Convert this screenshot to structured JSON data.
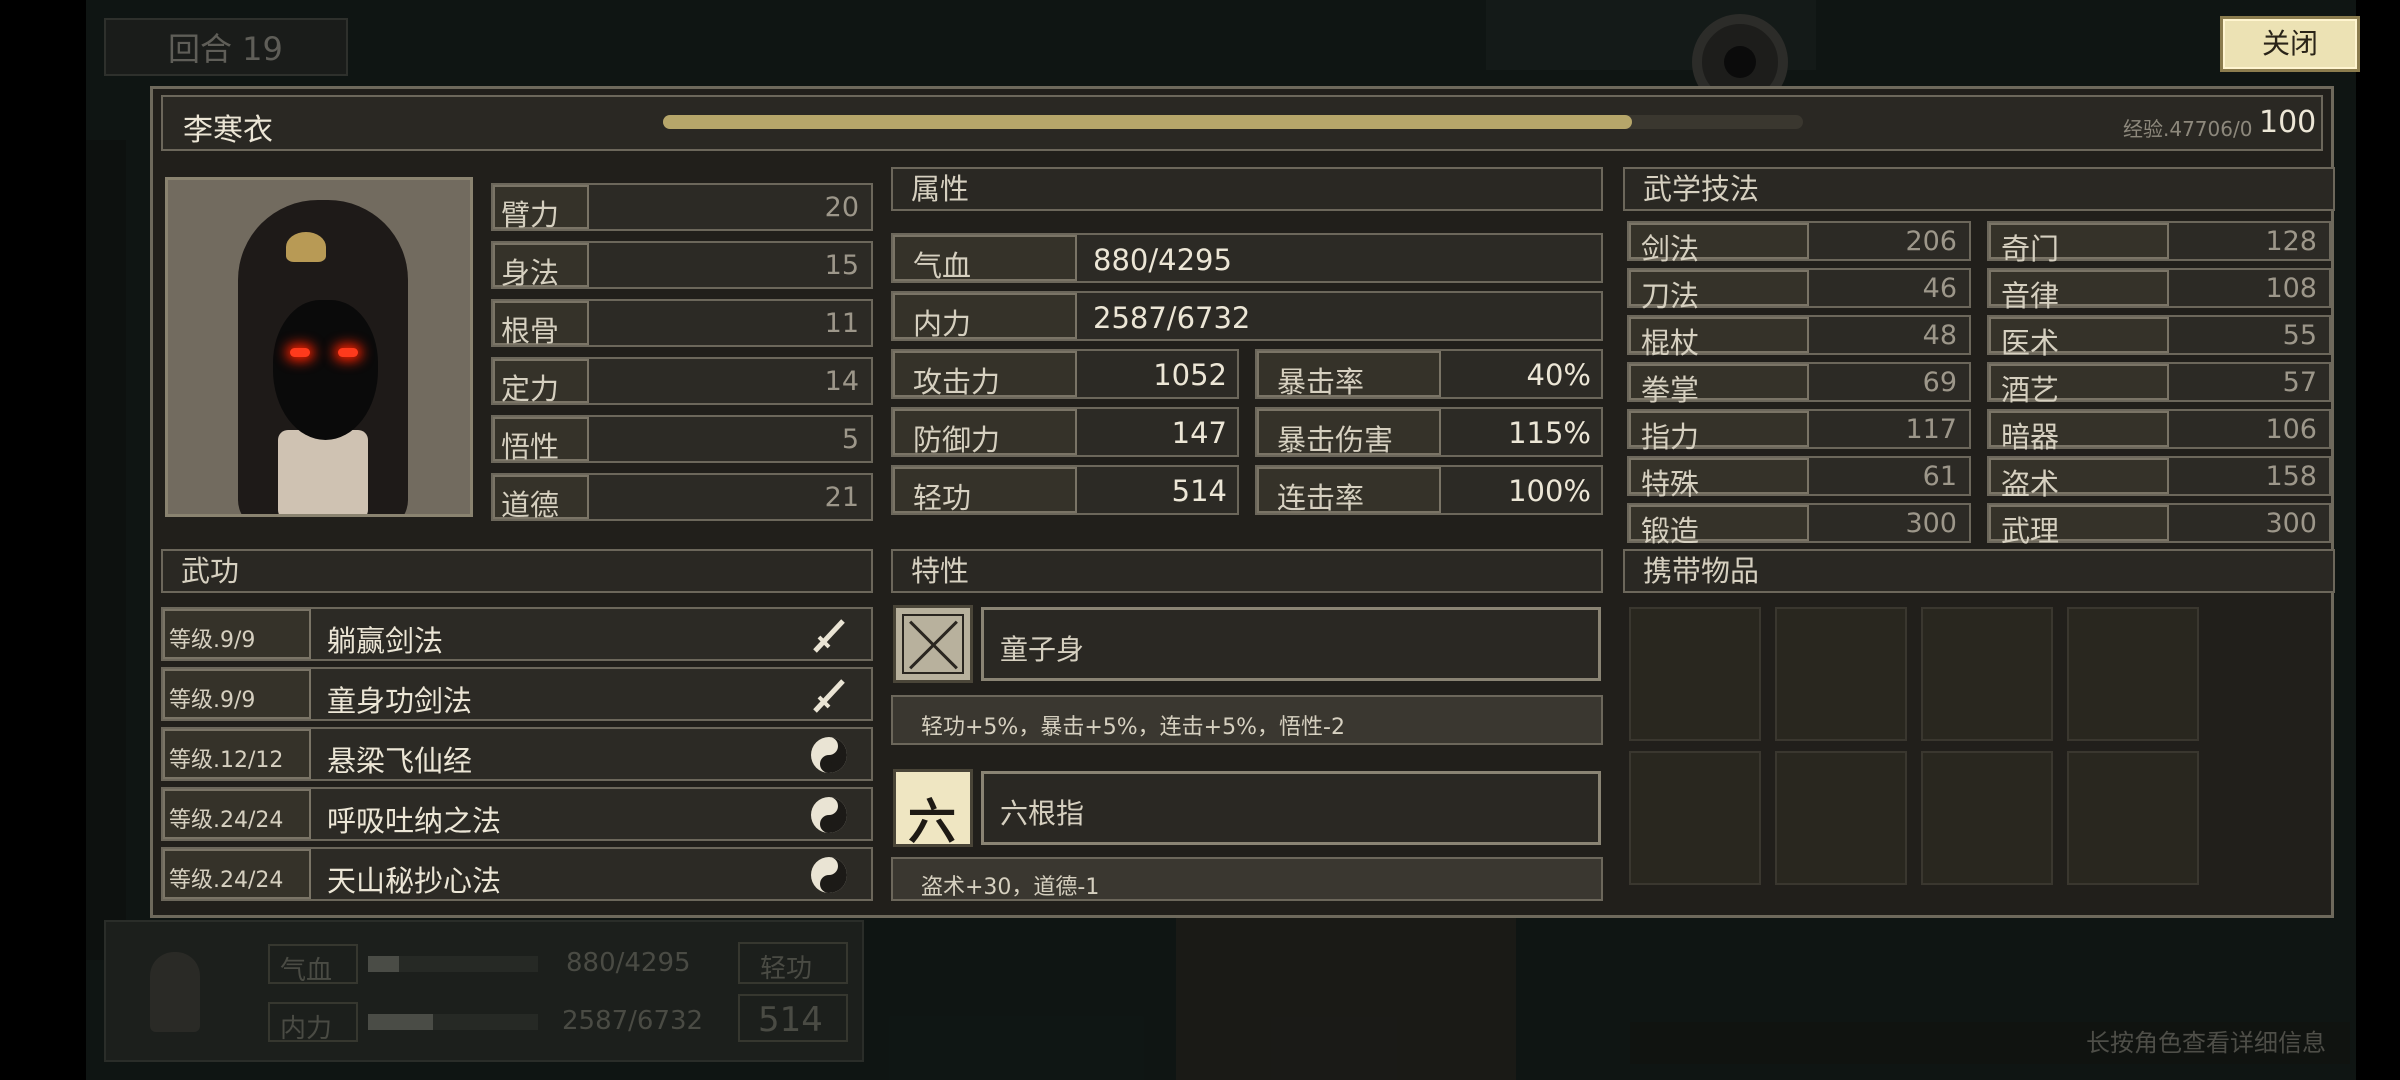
{
  "hud_top": {
    "turn": "回合 19"
  },
  "close_label": "关闭",
  "character": {
    "name": "李寒衣",
    "exp_label": "经验.47706/0",
    "level": "100",
    "exp_fill": 0.85
  },
  "base_stats": [
    {
      "label": "臂力",
      "value": "20"
    },
    {
      "label": "身法",
      "value": "15"
    },
    {
      "label": "根骨",
      "value": "11"
    },
    {
      "label": "定力",
      "value": "14"
    },
    {
      "label": "悟性",
      "value": "5"
    },
    {
      "label": "道德",
      "value": "21"
    }
  ],
  "attributes": {
    "title": "属性",
    "hp": {
      "label": "气血",
      "value": "880/4295"
    },
    "mp": {
      "label": "内力",
      "value": "2587/6732"
    },
    "left": [
      {
        "label": "攻击力",
        "value": "1052"
      },
      {
        "label": "防御力",
        "value": "147"
      },
      {
        "label": "轻功",
        "value": "514"
      }
    ],
    "right": [
      {
        "label": "暴击率",
        "value": "40%"
      },
      {
        "label": "暴击伤害",
        "value": "115%"
      },
      {
        "label": "连击率",
        "value": "100%"
      }
    ]
  },
  "skills": {
    "title": "武学技法",
    "left": [
      {
        "label": "剑法",
        "value": "206"
      },
      {
        "label": "刀法",
        "value": "46"
      },
      {
        "label": "棍杖",
        "value": "48"
      },
      {
        "label": "拳掌",
        "value": "69"
      },
      {
        "label": "指力",
        "value": "117"
      },
      {
        "label": "特殊",
        "value": "61"
      },
      {
        "label": "锻造",
        "value": "300"
      }
    ],
    "right": [
      {
        "label": "奇门",
        "value": "128"
      },
      {
        "label": "音律",
        "value": "108"
      },
      {
        "label": "医术",
        "value": "55"
      },
      {
        "label": "酒艺",
        "value": "57"
      },
      {
        "label": "暗器",
        "value": "106"
      },
      {
        "label": "盗术",
        "value": "158"
      },
      {
        "label": "武理",
        "value": "300"
      }
    ]
  },
  "martial_arts": {
    "title": "武功",
    "items": [
      {
        "level": "等级.9/9",
        "name": "躺赢剑法",
        "icon": "sword-icon"
      },
      {
        "level": "等级.9/9",
        "name": "童身功剑法",
        "icon": "sword-icon"
      },
      {
        "level": "等级.12/12",
        "name": "悬梁飞仙经",
        "icon": "yin-yang-icon"
      },
      {
        "level": "等级.24/24",
        "name": "呼吸吐纳之法",
        "icon": "yin-yang-icon"
      },
      {
        "level": "等级.24/24",
        "name": "天山秘抄心法",
        "icon": "yin-yang-icon"
      }
    ]
  },
  "traits": {
    "title": "特性",
    "items": [
      {
        "name": "童子身",
        "desc": "轻功+5%，暴击+5%，连击+5%，悟性-2",
        "icon_char": ""
      },
      {
        "name": "六根指",
        "desc": "盗术+30，道德-1",
        "icon_char": "六"
      }
    ]
  },
  "items_title": "携带物品",
  "hud_bottom": {
    "hp_label": "气血",
    "hp_value": "880/4295",
    "mp_label": "内力",
    "mp_value": "2587/6732",
    "speed_label": "轻功",
    "speed_value": "514"
  },
  "hint": "长按角色查看详细信息",
  "colors": {
    "exp_bar": "#b6a66a",
    "panel": "#211f1b",
    "border": "#6c675b",
    "close_bg": "#ece2b4"
  }
}
